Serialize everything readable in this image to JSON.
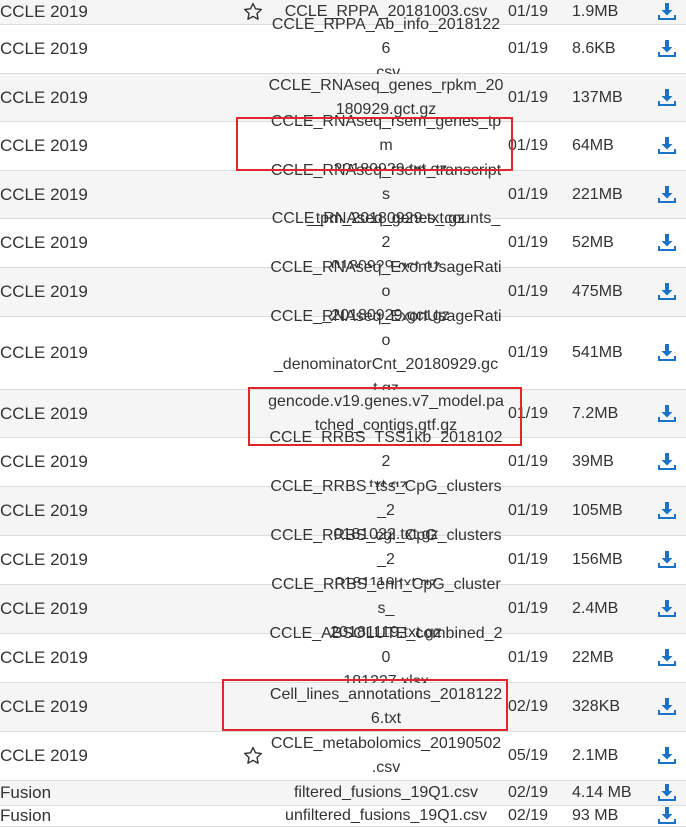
{
  "colors": {
    "download": "#1a73c9",
    "highlight": "#e0252b",
    "row_alt": "#f5f5f5"
  },
  "rows": [
    {
      "dataset": "CCLE 2019",
      "starred": true,
      "file": "CCLE_RPPA_20181003.csv",
      "date": "01/19",
      "size": "1.9MB"
    },
    {
      "dataset": "CCLE 2019",
      "starred": false,
      "file": "CCLE_RPPA_Ab_info_20181226.csv",
      "date": "01/19",
      "size": "8.6KB"
    },
    {
      "dataset": "CCLE 2019",
      "starred": false,
      "file": "CCLE_RNAseq_genes_rpkm_20180929.gct.gz",
      "date": "01/19",
      "size": "137MB"
    },
    {
      "dataset": "CCLE 2019",
      "starred": false,
      "file": "CCLE_RNAseq_rsem_genes_tpm_20180929.txt.gz",
      "date": "01/19",
      "size": "64MB"
    },
    {
      "dataset": "CCLE 2019",
      "starred": false,
      "file": "CCLE_RNAseq_rsem_transcripts_tpm_20180929.txt.gz",
      "date": "01/19",
      "size": "221MB"
    },
    {
      "dataset": "CCLE 2019",
      "starred": false,
      "file": "CCLE_RNAseq_genes_counts_20180929.gct.gz",
      "date": "01/19",
      "size": "52MB"
    },
    {
      "dataset": "CCLE 2019",
      "starred": false,
      "file": "CCLE_RNAseq_ExonUsageRatio_20180929.gct.gz",
      "date": "01/19",
      "size": "475MB"
    },
    {
      "dataset": "CCLE 2019",
      "starred": false,
      "file": "CCLE_RNAseq_ExonUsageRatio_denominatorCnt_20180929.gct.gz",
      "date": "01/19",
      "size": "541MB"
    },
    {
      "dataset": "CCLE 2019",
      "starred": false,
      "file": "gencode.v19.genes.v7_model.patched_contigs.gtf.gz",
      "date": "01/19",
      "size": "7.2MB"
    },
    {
      "dataset": "CCLE 2019",
      "starred": false,
      "file": "CCLE_RRBS_TSS1kb_20181022.txt.gz",
      "date": "01/19",
      "size": "39MB"
    },
    {
      "dataset": "CCLE 2019",
      "starred": false,
      "file": "CCLE_RRBS_tss_CpG_clusters_20181022.txt.gz",
      "date": "01/19",
      "size": "105MB"
    },
    {
      "dataset": "CCLE 2019",
      "starred": false,
      "file": "CCLE_RRBS_cgi_CpG_clusters_20181119.txt.gz",
      "date": "01/19",
      "size": "156MB"
    },
    {
      "dataset": "CCLE 2019",
      "starred": false,
      "file": "CCLE_RRBS_enh_CpG_clusters_20181119.txt.gz",
      "date": "01/19",
      "size": "2.4MB"
    },
    {
      "dataset": "CCLE 2019",
      "starred": false,
      "file": "CCLE_ABSOLUTE_combined_20181227.xlsx",
      "date": "01/19",
      "size": "22MB"
    },
    {
      "dataset": "CCLE 2019",
      "starred": false,
      "file": "Cell_lines_annotations_20181226.txt",
      "date": "02/19",
      "size": "328KB"
    },
    {
      "dataset": "CCLE 2019",
      "starred": true,
      "file": "CCLE_metabolomics_20190502.csv",
      "date": "05/19",
      "size": "2.1MB"
    },
    {
      "dataset": "Fusion",
      "starred": false,
      "file": "filtered_fusions_19Q1.csv",
      "date": "02/19",
      "size": "4.14 MB"
    },
    {
      "dataset": "Fusion",
      "starred": false,
      "file": "unfiltered_fusions_19Q1.csv",
      "date": "02/19",
      "size": "93 MB"
    }
  ]
}
